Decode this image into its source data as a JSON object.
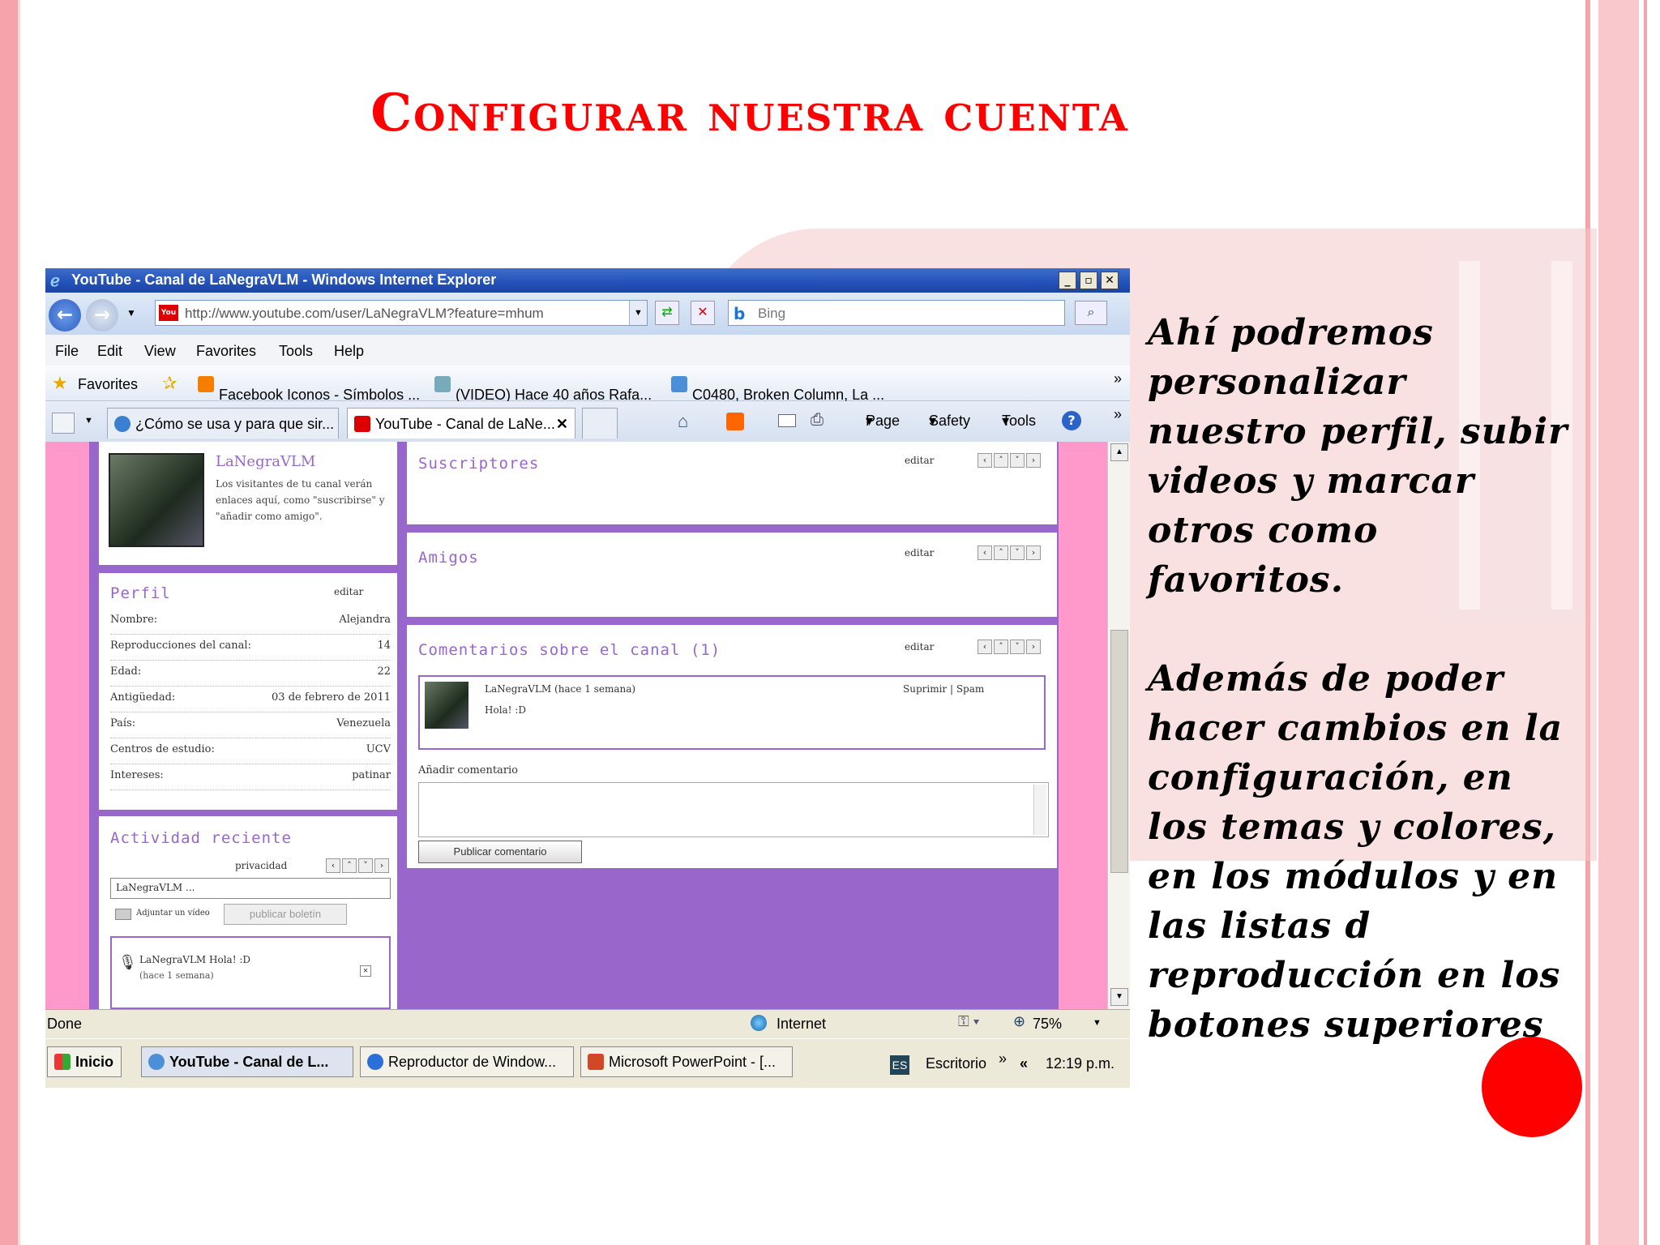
{
  "slide": {
    "title": "Configurar nuestra cuenta",
    "paragraph1": "Ahí podremos personalizar nuestro perfil, subir videos y marcar otros como favoritos.",
    "paragraph2": "Además de poder hacer cambios en la configuración, en los temas y colores, en los módulos y en las listas d reproducción en los botones superiores",
    "title_color": "#ff0000",
    "accent_color": "#f4a4aa"
  },
  "browser": {
    "window_title": "YouTube - Canal de LaNegraVLM - Windows Internet Explorer",
    "url": "http://www.youtube.com/user/LaNegraVLM?feature=mhum",
    "search_placeholder": "Bing",
    "menu": [
      "File",
      "Edit",
      "View",
      "Favorites",
      "Tools",
      "Help"
    ],
    "favorites_label": "Favorites",
    "favorites_links": [
      "Facebook Iconos - Símbolos ...",
      "(VIDEO) Hace 40 años Rafa...",
      "C0480, Broken Column, La ..."
    ],
    "tabs": [
      "¿Cómo se usa y para que sir...",
      "YouTube - Canal de LaNe..."
    ],
    "command_bar": [
      "Page",
      "Safety",
      "Tools"
    ],
    "chevron": "»",
    "close_tab": "✕",
    "win_buttons": [
      "_",
      "▫",
      "✕"
    ]
  },
  "channel": {
    "user_name": "LaNegraVLM",
    "user_note": "Los visitantes de tu canal verán enlaces aquí, como \"suscribirse\" y \"añadir como amigo\".",
    "profile": {
      "title": "Perfil",
      "edit_label": "editar",
      "rows": [
        {
          "label": "Nombre:",
          "value": "Alejandra"
        },
        {
          "label": "Reproducciones del canal:",
          "value": "14"
        },
        {
          "label": "Edad:",
          "value": "22"
        },
        {
          "label": "Antigüedad:",
          "value": "03 de febrero de 2011"
        },
        {
          "label": "País:",
          "value": "Venezuela"
        },
        {
          "label": "Centros de estudio:",
          "value": "UCV"
        },
        {
          "label": "Intereses:",
          "value": "patinar"
        }
      ]
    },
    "activity": {
      "title": "Actividad reciente",
      "privacy_label": "privacidad",
      "input_value": "LaNegraVLM ...",
      "attach_label": "Adjuntar un vídeo",
      "publish_label": "publicar boletín",
      "item_text": "LaNegraVLM Hola! :D",
      "item_time": "(hace 1 semana)"
    },
    "subscribers": {
      "title": "Suscriptores",
      "edit_label": "editar"
    },
    "friends": {
      "title": "Amigos",
      "edit_label": "editar"
    },
    "comments": {
      "title": "Comentarios sobre el canal (1)",
      "edit_label": "editar",
      "comment_author": "LaNegraVLM (hace 1 semana)",
      "comment_text": "Hola! :D",
      "comment_actions": "Suprimir | Spam",
      "add_label": "Añadir comentario",
      "publish_button": "Publicar comentario"
    }
  },
  "statusbar": {
    "status": "Done",
    "zone": "Internet",
    "zoom": "75%"
  },
  "taskbar": {
    "start": "Inicio",
    "tasks": [
      "YouTube - Canal de L...",
      "Reproductor de Window...",
      "Microsoft PowerPoint - [..."
    ],
    "lang": "ES",
    "desktop": "Escritorio",
    "clock": "12:19 p.m."
  }
}
